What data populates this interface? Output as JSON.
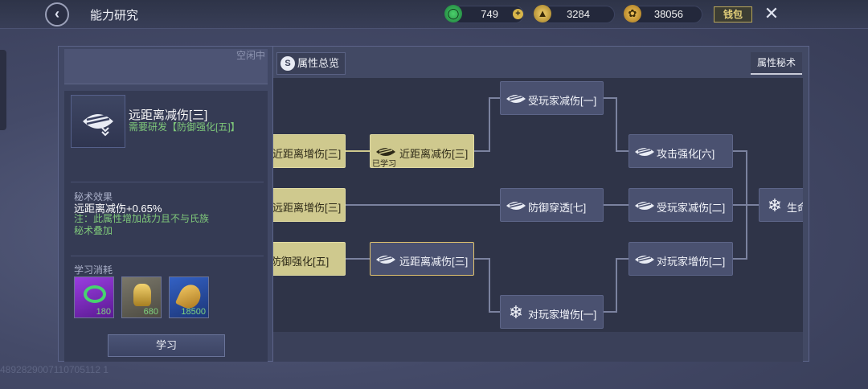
{
  "header": {
    "back_icon": "chevron-left-icon",
    "title": "能力研究",
    "currencies": [
      {
        "icon": "jade-coin-icon",
        "value": "749"
      },
      {
        "icon": "gold-ingot-icon",
        "value": "3284"
      },
      {
        "icon": "gold-leaf-icon",
        "value": "38056"
      }
    ],
    "wallet_label": "钱包",
    "close_icon": "close-icon"
  },
  "left": {
    "status": "空闲中",
    "skill": {
      "name": "远距离减伤[三]",
      "requirement": "需要研发【防御强化[五]】",
      "effect_title": "秘术效果",
      "effect_value": "远距离减伤+0.65%",
      "note_line1": "注：此属性增加战力且不与氏族",
      "note_line2": "秘术叠加"
    },
    "cost_title": "学习消耗",
    "costs": [
      {
        "icon": "jade-coin-icon",
        "amount": "180",
        "color": "#8a2bd1"
      },
      {
        "icon": "gold-ingot-icon",
        "amount": "680",
        "color": "#6d6a5c"
      },
      {
        "icon": "gold-leaf-icon",
        "amount": "18500",
        "color": "#2b4fa8"
      }
    ],
    "learn_button": "学习"
  },
  "right": {
    "overview_button": "属性总览",
    "tab_label": "属性秘术",
    "nodes": {
      "n1": {
        "label": "近距离增伤[三]",
        "state": "learned"
      },
      "n2": {
        "label": "远距离增伤[三]",
        "state": "learned"
      },
      "n3": {
        "label": "防御强化[五]",
        "state": "learned"
      },
      "n4": {
        "label": "近距离减伤[三]",
        "state": "learned",
        "tag": "已学习"
      },
      "n5": {
        "label": "远距离减伤[三]",
        "state": "selected"
      },
      "n6": {
        "label": "受玩家减伤[一]",
        "state": "locked"
      },
      "n7": {
        "label": "防御穿透[七]",
        "state": "locked"
      },
      "n8": {
        "label": "对玩家增伤[一]",
        "state": "locked"
      },
      "n9": {
        "label": "攻击强化[六]",
        "state": "locked"
      },
      "n10": {
        "label": "受玩家减伤[二]",
        "state": "locked"
      },
      "n11": {
        "label": "对玩家增伤[二]",
        "state": "locked"
      },
      "n12": {
        "label": "生命",
        "state": "locked"
      }
    }
  },
  "footer": {
    "uid": "4892829007110705112 1"
  },
  "colors": {
    "learned": "#cfc98e",
    "locked": "#4a5170",
    "selected_border": "#e2c46e",
    "green_text": "#7fc87a"
  }
}
